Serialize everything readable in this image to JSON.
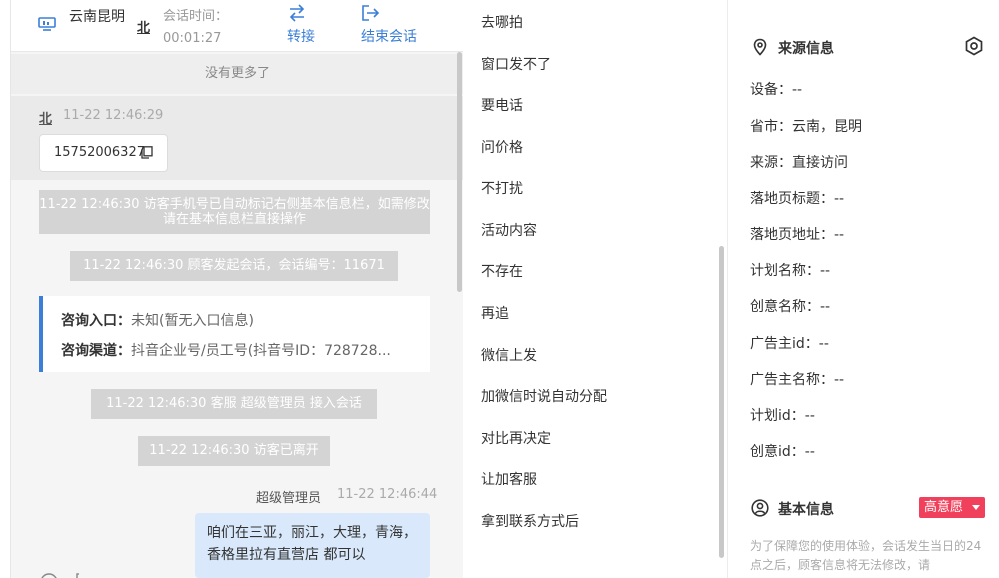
{
  "header": {
    "location": "云南昆明",
    "visitor_mark": "北",
    "time_label": "会话时间：",
    "time_value": "00:01:27",
    "transfer_label": "转接",
    "end_label": "结束会话"
  },
  "chat": {
    "no_more": "没有更多了",
    "visitor_name": "北",
    "visitor_time": "11-22 12:46:29",
    "phone": "15752006327",
    "sys_msg_1": "11-22 12:46:30 访客手机号已自动标记右侧基本信息栏，如需修改请在基本信息栏直接操作",
    "sys_msg_2": "11-22 12:46:30 顾客发起会话，会话编号：11671",
    "consult_entry_label": "咨询入口：",
    "consult_entry_value": "未知(暂无入口信息)",
    "consult_channel_label": "咨询渠道：",
    "consult_channel_value": "抖音企业号/员工号(抖音号ID：728728...",
    "sys_msg_3": "11-22 12:46:30 客服 超级管理员 接入会话",
    "sys_msg_4": "11-22 12:46:30 访客已离开",
    "agent_name": "超级管理员",
    "agent_time": "11-22 12:46:44",
    "agent_message": "咱们在三亚，丽江，大理，青海， 香格里拉有直营店 都可以"
  },
  "quick_replies": [
    "去哪拍",
    "窗口发不了",
    "要电话",
    "问价格",
    "不打扰",
    "活动内容",
    "不存在",
    "再追",
    "微信上发",
    "加微信时说自动分配",
    "对比再决定",
    "让加客服",
    "拿到联系方式后"
  ],
  "source_info": {
    "title": "来源信息",
    "fields": [
      "设备：--",
      "省市：云南，昆明",
      "来源：直接访问",
      "落地页标题：--",
      "落地页地址：--",
      "计划名称：--",
      "创意名称：--",
      "广告主id：--",
      "广告主名称：--",
      "计划id：--",
      "创意id：--"
    ]
  },
  "basic_info": {
    "title": "基本信息",
    "intent_badge": "高意愿",
    "notice": "为了保障您的使用体验，会话发生当日的24点之后，顾客信息将无法修改，请"
  },
  "colors": {
    "accent": "#3b7fd8",
    "intent_red": "#f0405b",
    "agent_bubble": "#d9e8fb"
  }
}
